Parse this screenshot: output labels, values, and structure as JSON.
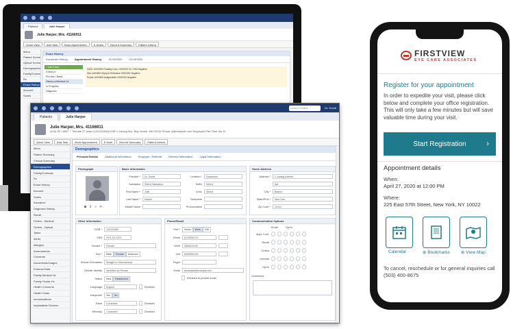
{
  "emr": {
    "tabs": [
      "Patients",
      "Julie Harper"
    ],
    "search_placeholder": "Search Charts",
    "user_label": "Dr. Gondi",
    "patient": {
      "name": "Julie Harper, Mrs. 41166911",
      "line1": "(415) 917-8607  ♀ Female  37 years  (12/24/1982)  EHR 1 Joining Ave, Bay House, MA 02134  Phone: jf@example.com  Employed Part Time  Ins: B"
    },
    "actions": [
      "Quick View",
      "Add Task",
      "Book Appointment",
      "E-Note",
      "Record Summary",
      "Patient Letters"
    ],
    "sidebar": [
      "Menu",
      "Patient Summary",
      "Clinical Summary",
      "Demographics",
      "Family/Contacts",
      "Rx",
      "Exam History",
      "Account",
      "Scans",
      "Insurance",
      "Diagnosis History",
      "Recall",
      "Orders - Medical",
      "Orders - Optical",
      "Tasks",
      "Alerts",
      "Allergies",
      "Amendments",
      "Consents",
      "Documents/Images",
      "External Data",
      "Family Medical Hx",
      "Family Ocular Hx",
      "Health Concerns",
      "Health Goals",
      "Immunizations",
      "Implantable Devices"
    ],
    "section": "Demographics",
    "subtabs": [
      "Personal Details",
      "Additional Information",
      "Employer / Referral",
      "Referral Information",
      "Legal Information"
    ],
    "photo_title": "Photograph",
    "basic": {
      "title": "Basic Information",
      "provider_label": "Provider *",
      "provider": "Dr. Gondi",
      "location_label": "Location *",
      "location": "Downtown",
      "salutation_label": "Salutation",
      "salutation": "Select Salutation",
      "suffix_label": "Suffix",
      "suffix": "Select",
      "first_label": "First Name *",
      "first": "Julie",
      "cred_label": "Cred.",
      "cred": "Select",
      "last_label": "Last Name *",
      "last": "Harper",
      "nickname_label": "Nickname",
      "middle_label": "Middle Name",
      "pronoun_label": "Pronunciation"
    },
    "home": {
      "title": "Home Address",
      "address_label": "Address *",
      "address": "1 Joining Avenue",
      "line2": "Apt",
      "city_label": "City *",
      "city": "Boston",
      "state_label": "State/Prov *",
      "state": "New York",
      "zip_label": "Zip Code *",
      "zip": "11013"
    },
    "other": {
      "title": "Other Information",
      "dob_label": "DOB *",
      "dob": "12/24/1982",
      "ssn_label": "SSN",
      "ssn": "XXX-XX-2222",
      "gender_label": "Gender *",
      "gender": "Female",
      "sex_label": "Sex *",
      "sex_opts": [
        "Male",
        "Female",
        "Unknown"
      ],
      "orient_label": "Sexual Orientation",
      "orient": "Straight or heterosexual",
      "identity_label": "Gender Identity",
      "identity": "Identifies as Female",
      "status_label": "Status",
      "status_opts": [
        "New",
        "Established"
      ],
      "lang_label": "Language",
      "lang": "English",
      "interp_label": "Interpreter",
      "interp_opts": [
        "Yes",
        "No"
      ],
      "race_label": "Race",
      "race": "0 selected",
      "eth_label": "Ethnicity",
      "eth": "1 selected",
      "declined": "Declined"
    },
    "phone_email": {
      "title": "Phone/Email",
      "pref_label": "Pref *",
      "pref_opts": [
        "Home",
        "Work",
        "Cell"
      ],
      "home_label": "Home",
      "home": "6175550174",
      "work_label": "Work",
      "work": "4065220102",
      "cell_label": "Cell",
      "cell": "6535550129",
      "pager_label": "Pager",
      "email_label": "Email",
      "email": "jfexample@example.com",
      "no_email": "Declined to provide email"
    },
    "comm": {
      "title": "Communication Options",
      "cols": [
        "Email",
        "Opt In"
      ],
      "rows": [
        "Appt. Conf.",
        "Recall",
        "Orders",
        "General",
        "Opt in"
      ],
      "comments": "Comments"
    }
  },
  "backwin": {
    "tabs": [
      "Patients",
      "Julie Harper"
    ],
    "patient": "Julie Harper, Mrs. 41166911",
    "subtabs": [
      "Encounter History",
      "Appointment History",
      "01/19/2020",
      "01/19/2020"
    ],
    "actions": [
      "Scroll View",
      "Add Task",
      "Book Appointment",
      "E-Notes",
      "Record Summary",
      "Patient Letters"
    ],
    "sidebar": [
      "Menu",
      "Patient Summary",
      "Optical Summary",
      "Demographics",
      "Family/Contacts",
      "Rx",
      "Exam History",
      "Account",
      "Scans"
    ],
    "panel": "Exam History",
    "items": [
      "+ Add Exam",
      "Check-In",
      "Pre-test / Basic",
      "History w/Medical Dx",
      "In Progress",
      "Diagnosis"
    ],
    "notes": [
      "DIAG: A0008/R Floating Lens, H00/H00 00 / H00 Negative",
      "Dist: A0008/H Myopia Refraction H00/H00 Negative",
      "Pupils: A0008/H Astigmatism H00/H00 Negative"
    ]
  },
  "phone": {
    "logo_line1": "FIRSTVIEW",
    "logo_line2": "EYE CARE ASSOCIATES",
    "heading": "Register for your appointment",
    "text": "In order to expedite your visit, please click below and complete your office registration. This will only take a few minutes but will save valuable time during your visit.",
    "start_button": "Start Registration",
    "details_heading": "Appointment details",
    "when_label": "When:",
    "when": "April 27, 2020 at 12:00 PM",
    "where_label": "Where:",
    "where": "225 East 57th Street, New York, NY 10022",
    "calendar": "Calendar",
    "bookmarks": "Bookmarks",
    "view_map": "View Map",
    "cancel_text": "To cancel, reschedule or for general inquiries call (503) 400-8675"
  }
}
